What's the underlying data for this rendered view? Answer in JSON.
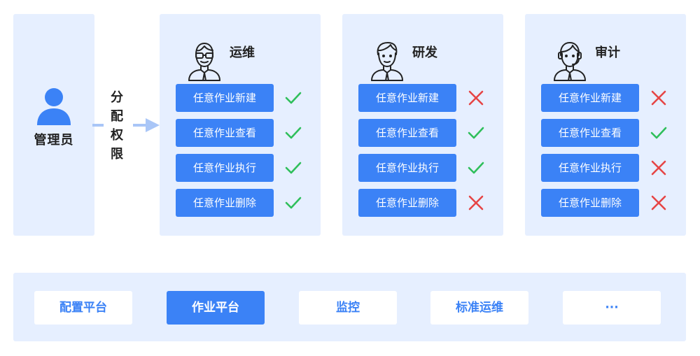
{
  "colors": {
    "panel": "#e6efff",
    "accent": "#3b82f6",
    "check": "#2fbf5b",
    "cross": "#e64545"
  },
  "admin": {
    "label": "管理员",
    "icon": "user-icon"
  },
  "assign": {
    "chars": [
      "分",
      "配",
      "权",
      "限"
    ],
    "icon": "arrow-right-icon"
  },
  "roles": [
    {
      "name": "运维",
      "avatar": "ops-engineer-avatar-icon",
      "permissions": [
        {
          "label": "任意作业新建",
          "allowed": true
        },
        {
          "label": "任意作业查看",
          "allowed": true
        },
        {
          "label": "任意作业执行",
          "allowed": true
        },
        {
          "label": "任意作业删除",
          "allowed": true
        }
      ]
    },
    {
      "name": "研发",
      "avatar": "developer-avatar-icon",
      "permissions": [
        {
          "label": "任意作业新建",
          "allowed": false
        },
        {
          "label": "任意作业查看",
          "allowed": true
        },
        {
          "label": "任意作业执行",
          "allowed": true
        },
        {
          "label": "任意作业删除",
          "allowed": false
        }
      ]
    },
    {
      "name": "审计",
      "avatar": "auditor-avatar-icon",
      "permissions": [
        {
          "label": "任意作业新建",
          "allowed": false
        },
        {
          "label": "任意作业查看",
          "allowed": true
        },
        {
          "label": "任意作业执行",
          "allowed": false
        },
        {
          "label": "任意作业删除",
          "allowed": false
        }
      ]
    }
  ],
  "platforms": [
    {
      "label": "配置平台",
      "active": false
    },
    {
      "label": "作业平台",
      "active": true
    },
    {
      "label": "监控",
      "active": false
    },
    {
      "label": "标准运维",
      "active": false
    },
    {
      "label": "···",
      "active": false
    }
  ]
}
